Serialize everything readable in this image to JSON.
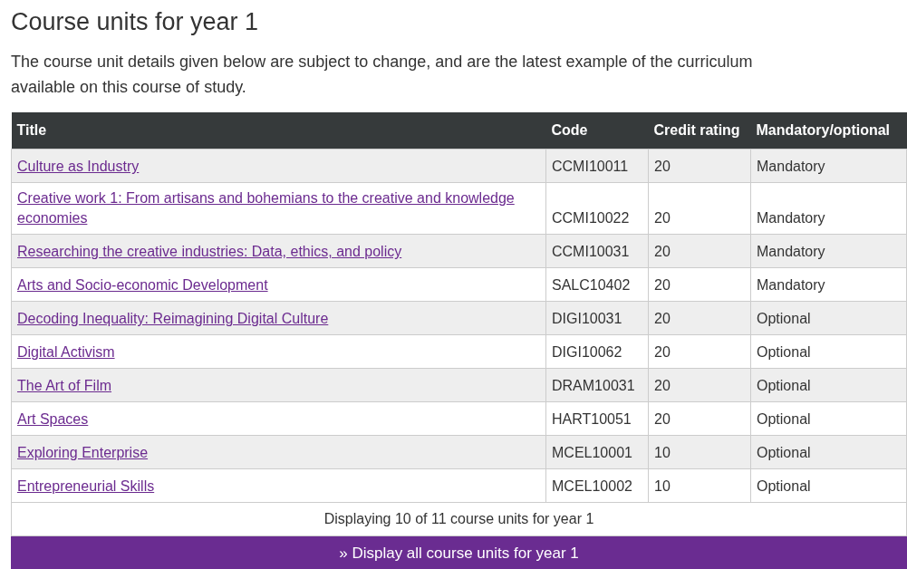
{
  "heading": "Course units for year 1",
  "intro": "The course unit details given below are subject to change, and are the latest example of the curriculum available on this course of study.",
  "table": {
    "columns": [
      "Title",
      "Code",
      "Credit rating",
      "Mandatory/optional"
    ],
    "rows": [
      {
        "title": "Culture as Industry",
        "code": "CCMI10011",
        "credit": "20",
        "status": "Mandatory"
      },
      {
        "title": "Creative work 1: From artisans and bohemians to the creative and knowledge economies",
        "code": "CCMI10022",
        "credit": "20",
        "status": "Mandatory"
      },
      {
        "title": "Researching the creative industries: Data, ethics, and policy",
        "code": "CCMI10031",
        "credit": "20",
        "status": "Mandatory"
      },
      {
        "title": "Arts and Socio-economic Development",
        "code": "SALC10402",
        "credit": "20",
        "status": "Mandatory"
      },
      {
        "title": "Decoding Inequality: Reimagining Digital Culture",
        "code": "DIGI10031",
        "credit": "20",
        "status": "Optional"
      },
      {
        "title": "Digital Activism",
        "code": "DIGI10062",
        "credit": "20",
        "status": "Optional"
      },
      {
        "title": "The Art of Film",
        "code": "DRAM10031",
        "credit": "20",
        "status": "Optional"
      },
      {
        "title": "Art Spaces",
        "code": "HART10051",
        "credit": "20",
        "status": "Optional"
      },
      {
        "title": "Exploring Enterprise",
        "code": "MCEL10001",
        "credit": "10",
        "status": "Optional"
      },
      {
        "title": "Entrepreneurial Skills",
        "code": "MCEL10002",
        "credit": "10",
        "status": "Optional"
      }
    ],
    "summary": "Displaying 10 of 11 course units for year 1"
  },
  "show_all_button": "» Display all course units for year 1"
}
